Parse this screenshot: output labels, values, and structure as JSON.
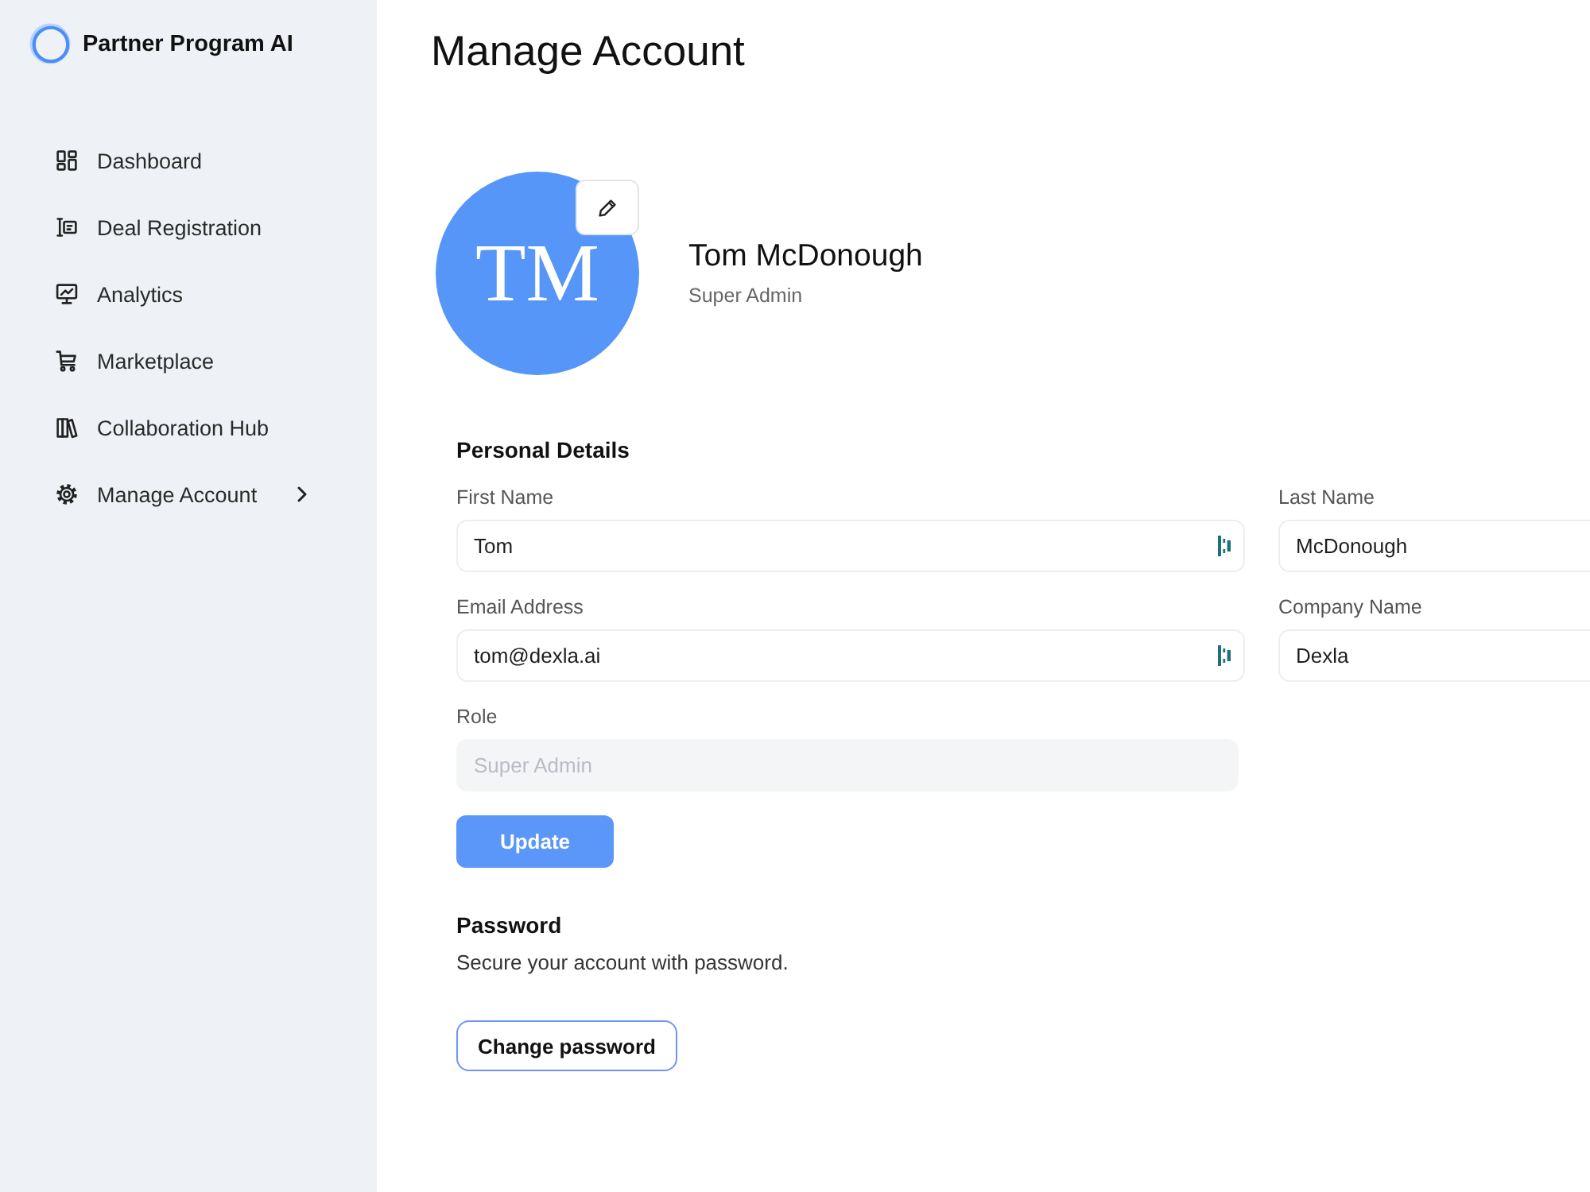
{
  "sidebar": {
    "brand": "Partner Program AI",
    "items": [
      {
        "label": "Dashboard",
        "expandable": false
      },
      {
        "label": "Deal Registration",
        "expandable": false
      },
      {
        "label": "Analytics",
        "expandable": false
      },
      {
        "label": "Marketplace",
        "expandable": false
      },
      {
        "label": "Collaboration Hub",
        "expandable": false
      },
      {
        "label": "Manage Account",
        "expandable": true
      }
    ]
  },
  "page": {
    "title": "Manage Account"
  },
  "profile": {
    "initials": "TM",
    "name": "Tom McDonough",
    "role": "Super Admin"
  },
  "personal_details": {
    "heading": "Personal Details",
    "fields": [
      {
        "label": "First Name",
        "value": "Tom",
        "disabled": false,
        "autofill_icon": true
      },
      {
        "label": "Last Name",
        "value": "McDonough",
        "disabled": false,
        "autofill_icon": false
      },
      {
        "label": "Email Address",
        "value": "tom@dexla.ai",
        "disabled": false,
        "autofill_icon": true
      },
      {
        "label": "Company Name",
        "value": "Dexla",
        "disabled": false,
        "autofill_icon": false
      },
      {
        "label": "Role",
        "value": "Super Admin",
        "disabled": true,
        "autofill_icon": false
      }
    ],
    "button": "Update"
  },
  "password": {
    "heading": "Password",
    "description": "Secure your account with password.",
    "button": "Change password"
  }
}
